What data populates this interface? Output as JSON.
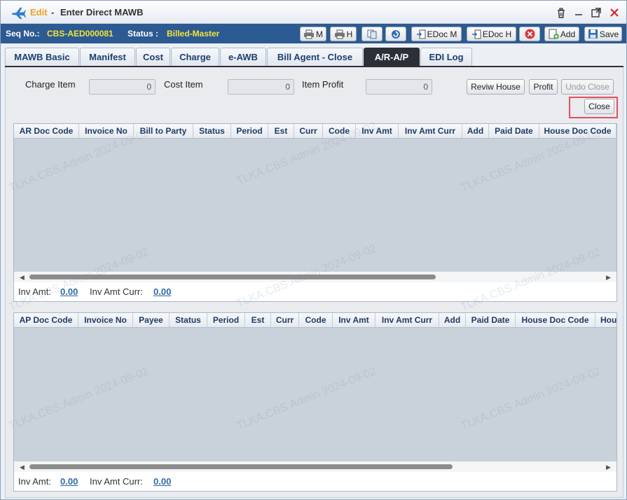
{
  "title": {
    "mode": "Edit",
    "separator": "-",
    "name": "Enter Direct MAWB"
  },
  "status_bar": {
    "seq_label": "Seq No.:",
    "seq_value": "CBS-AED000081",
    "status_label": "Status :",
    "status_value": "Billed-Master",
    "buttons": [
      {
        "label": "M",
        "icon": "printer-icon"
      },
      {
        "label": "H",
        "icon": "printer-icon"
      },
      {
        "label": "",
        "icon": "copy-icon"
      },
      {
        "label": "",
        "icon": "refresh-icon"
      },
      {
        "label": "EDoc M",
        "icon": "edoc-icon"
      },
      {
        "label": "EDoc H",
        "icon": "edoc-icon"
      },
      {
        "label": "",
        "icon": "delete-icon"
      },
      {
        "label": "Add",
        "icon": "add-document-icon"
      },
      {
        "label": "Save",
        "icon": "save-icon"
      }
    ]
  },
  "tabs": [
    {
      "label": "MAWB Basic",
      "active": false
    },
    {
      "label": "Manifest",
      "active": false
    },
    {
      "label": "Cost",
      "active": false
    },
    {
      "label": "Charge",
      "active": false
    },
    {
      "label": "e-AWB",
      "active": false
    },
    {
      "label": "Bill Agent - Close",
      "active": false
    },
    {
      "label": "A/R-A/P",
      "active": true
    },
    {
      "label": "EDI Log",
      "active": false
    }
  ],
  "summary": {
    "charge_item_label": "Charge Item",
    "charge_item_value": "0",
    "cost_item_label": "Cost Item",
    "cost_item_value": "0",
    "item_profit_label": "Item Profit",
    "item_profit_value": "0"
  },
  "actions": {
    "review_house": "Reviw House",
    "profit": "Profit",
    "undo_close": "Undo Close",
    "close": "Close"
  },
  "ar_grid": {
    "columns": [
      "AR Doc Code",
      "Invoice No",
      "Bill to Party",
      "Status",
      "Period",
      "Est",
      "Curr",
      "Code",
      "Inv Amt",
      "Inv Amt Curr",
      "Add",
      "Paid Date",
      "House Doc Code"
    ],
    "rows": [],
    "footer": {
      "inv_amt_label": "Inv Amt:",
      "inv_amt_value": "0.00",
      "inv_amt_curr_label": "Inv Amt Curr:",
      "inv_amt_curr_value": "0.00"
    }
  },
  "ap_grid": {
    "columns": [
      "AP Doc Code",
      "Invoice No",
      "Payee",
      "Status",
      "Period",
      "Est",
      "Curr",
      "Code",
      "Inv Amt",
      "Inv Amt Curr",
      "Add",
      "Paid Date",
      "House Doc Code",
      "Hou"
    ],
    "rows": [],
    "footer": {
      "inv_amt_label": "Inv Amt:",
      "inv_amt_value": "0.00",
      "inv_amt_curr_label": "Inv Amt Curr:",
      "inv_amt_curr_value": "0.00"
    }
  },
  "watermark_text": "TLKA.CBS.Admin 2024-09-02"
}
